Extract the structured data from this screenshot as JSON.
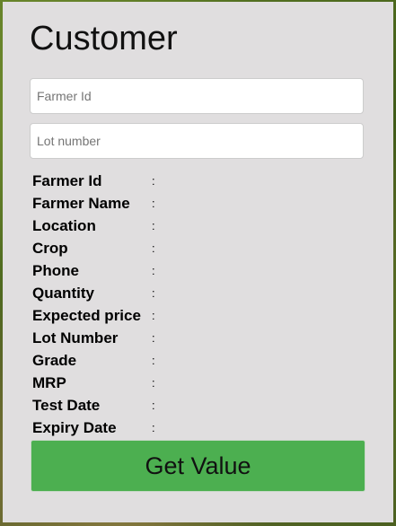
{
  "form": {
    "title": "Customer",
    "farmer_id_input": {
      "placeholder": "Farmer Id",
      "value": ""
    },
    "lot_number_input": {
      "placeholder": "Lot number",
      "value": ""
    },
    "details": [
      {
        "label": "Farmer Id",
        "separator": ":",
        "value": ""
      },
      {
        "label": "Farmer Name",
        "separator": ":",
        "value": ""
      },
      {
        "label": "Location",
        "separator": ":",
        "value": ""
      },
      {
        "label": "Crop",
        "separator": ":",
        "value": ""
      },
      {
        "label": "Phone",
        "separator": ":",
        "value": ""
      },
      {
        "label": "Quantity",
        "separator": ":",
        "value": ""
      },
      {
        "label": "Expected price",
        "separator": ":",
        "value": ""
      },
      {
        "label": "Lot Number",
        "separator": ":",
        "value": ""
      },
      {
        "label": "Grade",
        "separator": ":",
        "value": ""
      },
      {
        "label": "MRP",
        "separator": ":",
        "value": ""
      },
      {
        "label": "Test Date",
        "separator": ":",
        "value": ""
      },
      {
        "label": "Expiry Date",
        "separator": ":",
        "value": ""
      }
    ],
    "submit_label": "Get Value"
  },
  "colors": {
    "card_background": "#e0dedf",
    "button_background": "#4caf50",
    "input_border": "#cccccc"
  }
}
